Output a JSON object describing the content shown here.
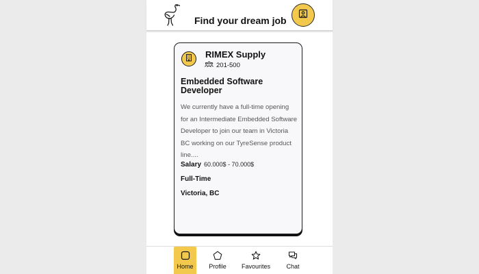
{
  "header": {
    "title": "Find your dream job",
    "logo_icon": "ostrich-logo-icon",
    "action_icon": "profile-card-icon"
  },
  "job_card": {
    "company_icon": "building-icon",
    "company_name": "RIMEX Supply",
    "size_icon": "users-icon",
    "company_size": "201-500",
    "job_title": "Embedded Software Developer",
    "description": "We currently have a full-time opening for an Intermediate Embedded Software Developer to join our team in Victoria BC working on our TyreSense product line....",
    "salary_label": "Salary",
    "salary_value": "60.000$ - 70.000$",
    "job_type": "Full-Time",
    "location": "Victoria, BC"
  },
  "bottom_nav": {
    "items": [
      {
        "label": "Home",
        "icon": "home-icon",
        "active": true
      },
      {
        "label": "Profile",
        "icon": "profile-icon",
        "active": false
      },
      {
        "label": "Favourites",
        "icon": "star-icon",
        "active": false
      },
      {
        "label": "Chat",
        "icon": "chat-icon",
        "active": false
      }
    ]
  },
  "colors": {
    "accent": "#f2c94c",
    "background": "#ebebeb",
    "card": "#f8f8fa",
    "text": "#111111"
  }
}
